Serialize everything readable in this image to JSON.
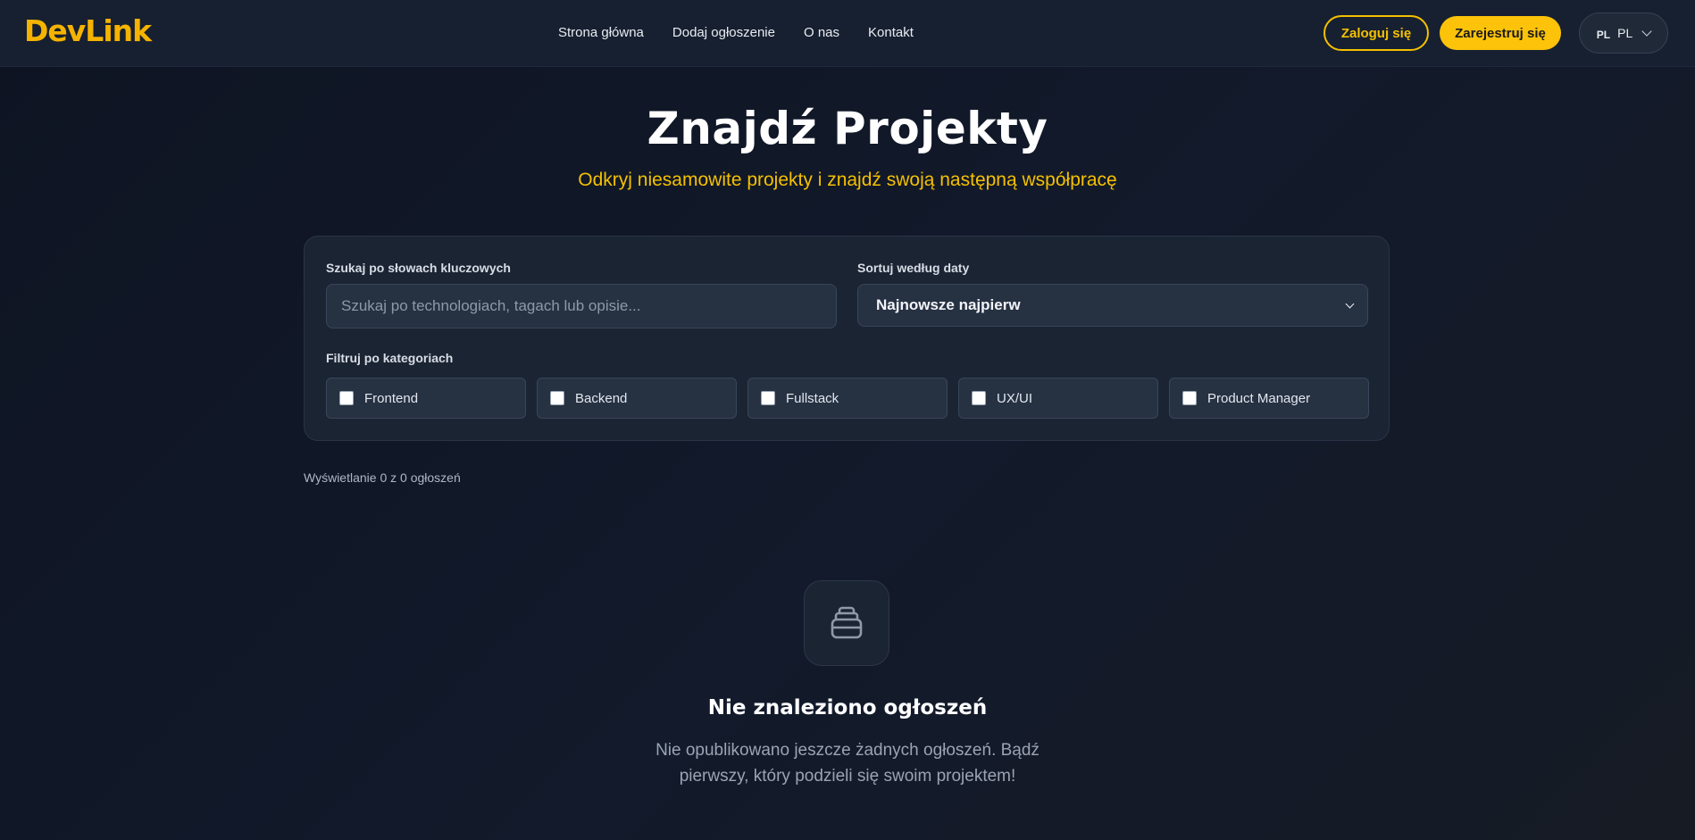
{
  "header": {
    "logo": "DevLink",
    "nav": [
      "Strona główna",
      "Dodaj ogłoszenie",
      "O nas",
      "Kontakt"
    ],
    "login_label": "Zaloguj się",
    "register_label": "Zarejestruj się",
    "lang_flag": "PL",
    "lang_code": "PL"
  },
  "hero": {
    "title": "Znajdź Projekty",
    "subtitle": "Odkryj niesamowite projekty i znajdź swoją następną współpracę"
  },
  "filters": {
    "search_label": "Szukaj po słowach kluczowych",
    "search_placeholder": "Szukaj po technologiach, tagach lub opisie...",
    "search_value": "",
    "sort_label": "Sortuj według daty",
    "sort_value": "Najnowsze najpierw",
    "categories_label": "Filtruj po kategoriach",
    "categories": [
      {
        "label": "Frontend",
        "checked": false
      },
      {
        "label": "Backend",
        "checked": false
      },
      {
        "label": "Fullstack",
        "checked": false
      },
      {
        "label": "UX/UI",
        "checked": false
      },
      {
        "label": "Product Manager",
        "checked": false
      }
    ]
  },
  "results": {
    "count_text": "Wyświetlanie 0 z 0 ogłoszeń"
  },
  "empty_state": {
    "icon": "archive-box-icon",
    "title": "Nie znaleziono ogłoszeń",
    "description": "Nie opublikowano jeszcze żadnych ogłoszeń. Bądź pierwszy, który podzieli się swoim projektem!"
  },
  "colors": {
    "accent": "#fcc30a",
    "background": "#0e1422",
    "card": "#1b2433"
  }
}
